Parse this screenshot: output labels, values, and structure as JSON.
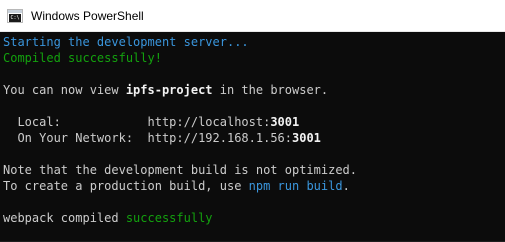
{
  "window": {
    "title": "Windows PowerShell",
    "icon": "powershell-console-icon",
    "icon_text": "C:\\"
  },
  "colors": {
    "titlebar_bg": "#ffffff",
    "console_bg": "#0c0c0c",
    "default_text": "#cccccc",
    "blue": "#3a96dd",
    "green": "#13a10e",
    "bright_white": "#f2f2f2"
  },
  "console": {
    "line1": "Starting the development server...",
    "line2": "Compiled successfully!",
    "line3_prefix": "You can now view ",
    "line3_project": "ipfs-project",
    "line3_suffix": " in the browser.",
    "local_label": "  Local:            ",
    "local_prefix": "http://localhost:",
    "local_port": "3001",
    "network_label": "  On Your Network:  ",
    "network_prefix": "http://192.168.1.56:",
    "network_port": "3001",
    "note_line": "Note that the development build is not optimized.",
    "prod_prefix": "To create a production build, use ",
    "prod_command": "npm run build",
    "prod_suffix": ".",
    "webpack_prefix": "webpack compiled ",
    "webpack_status": "successfully"
  }
}
